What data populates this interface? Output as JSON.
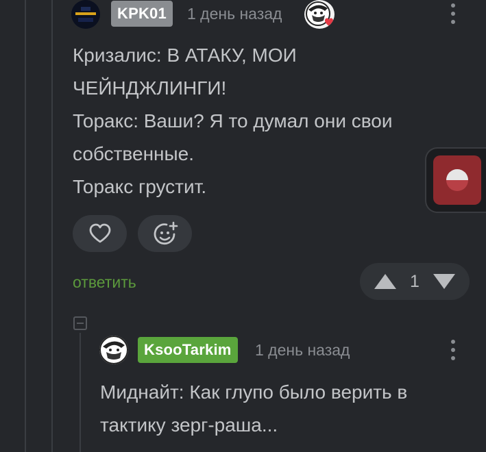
{
  "comment1": {
    "author": "KPK01",
    "time": "1 день назад",
    "lines": [
      "Кризалис: В АТАКУ, МОИ",
      "ЧЕЙНДЖЛИНГИ!",
      "Торакс: Ваши? Я то думал они свои",
      "собственные.",
      "Торакс грустит."
    ],
    "reply_label": "ответить",
    "rating": "1",
    "colors": {
      "badge": "#8a8d91"
    }
  },
  "comment2": {
    "author": "KsooTarkim",
    "time": "1 день назад",
    "lines": [
      "Миднайт: Как глупо было верить в",
      "тактику зерг-раша..."
    ],
    "colors": {
      "badge": "#5aa53c"
    }
  },
  "icons": {
    "like": "heart-icon",
    "reaction": "smiley-plus-icon",
    "upvote": "triangle-up-icon",
    "downvote": "triangle-down-icon",
    "menu": "kebab-icon"
  }
}
